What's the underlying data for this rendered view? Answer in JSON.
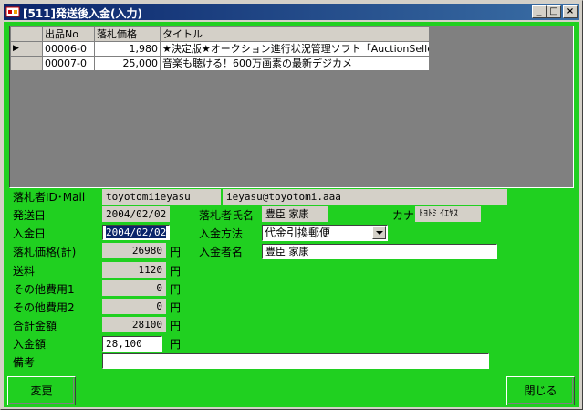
{
  "window": {
    "title": "[511]発送後入金(入力)",
    "min": "_",
    "max": "□",
    "close": "×"
  },
  "grid": {
    "headers": {
      "item_no": "出品No",
      "price": "落札価格",
      "title": "タイトル"
    },
    "rows": [
      {
        "indicator": "▶",
        "item_no": "00006-0",
        "price": "1,980",
        "title": "★決定版★オークション進行状況管理ソフト「AuctionSeller"
      },
      {
        "indicator": "",
        "item_no": "00007-0",
        "price": "25,000",
        "title": "音楽も聴ける！600万画素の最新デジカメ"
      }
    ]
  },
  "form": {
    "bidder_id_label": "落札者ID･Mail",
    "bidder_id": "toyotomiieyasu",
    "bidder_mail": "ieyasu@toyotomi.aaa",
    "ship_date_label": "発送日",
    "ship_date": "2004/02/02",
    "bidder_name_label": "落札者氏名",
    "bidder_name": "豊臣 家康",
    "kana_label": "カナ",
    "kana": "ﾄﾖﾄﾐ ｲｴﾔｽ",
    "pay_date_label": "入金日",
    "pay_date": "2004/02/02",
    "pay_method_label": "入金方法",
    "pay_method": "代金引換郵便",
    "payer_label": "入金者名",
    "payer": "豊臣 家康",
    "price_total_label": "落札価格(計)",
    "price_total": "26980",
    "shipping_label": "送料",
    "shipping": "1120",
    "other1_label": "その他費用1",
    "other1": "0",
    "other2_label": "その他費用2",
    "other2": "0",
    "total_label": "合計金額",
    "total": "28100",
    "pay_amount_label": "入金額",
    "pay_amount": "28,100",
    "yen": "円",
    "note_label": "備考",
    "note": ""
  },
  "buttons": {
    "change": "変更",
    "close": "閉じる"
  }
}
